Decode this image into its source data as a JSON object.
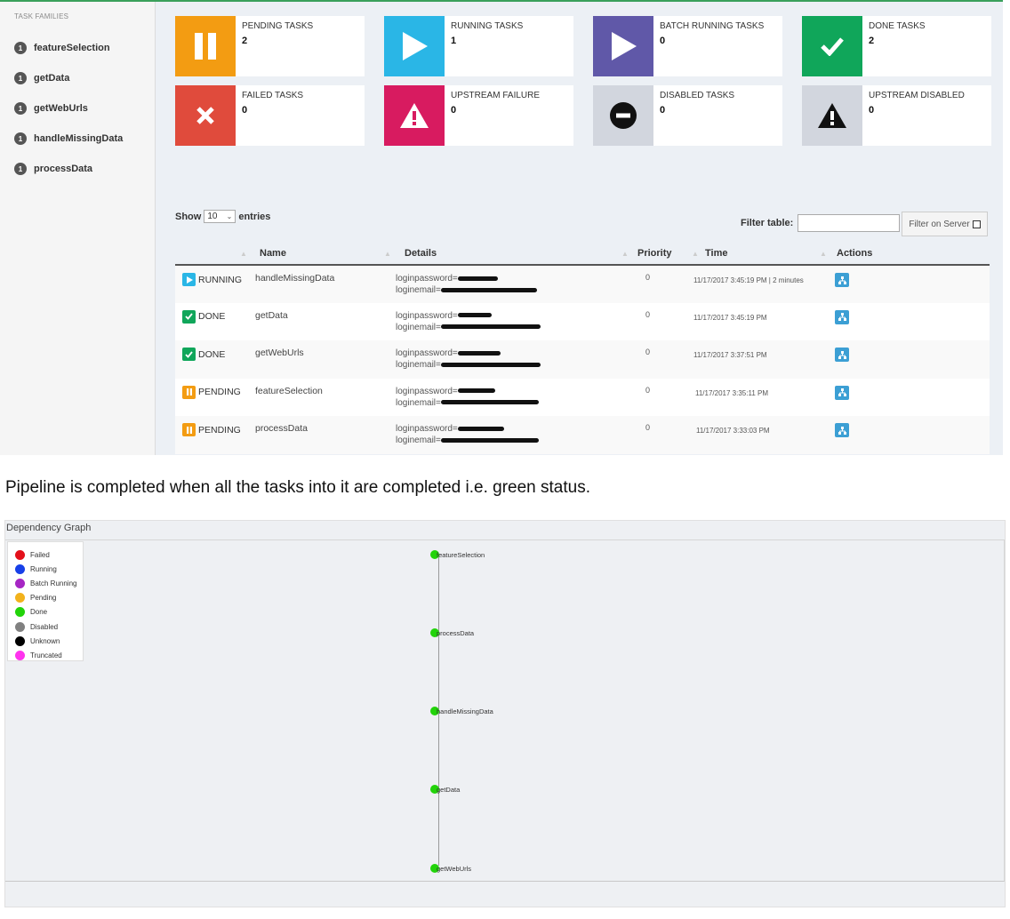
{
  "sidebar": {
    "header": "TASK FAMILIES",
    "items": [
      {
        "count": "1",
        "label": "featureSelection"
      },
      {
        "count": "1",
        "label": "getData"
      },
      {
        "count": "1",
        "label": "getWebUrls"
      },
      {
        "count": "1",
        "label": "handleMissingData"
      },
      {
        "count": "1",
        "label": "processData"
      }
    ]
  },
  "status_boxes": [
    {
      "label": "PENDING TASKS",
      "count": "2",
      "color": "#f39c12",
      "icon": "pause-icon"
    },
    {
      "label": "RUNNING TASKS",
      "count": "1",
      "color": "#2ab6e6",
      "icon": "play-icon"
    },
    {
      "label": "BATCH RUNNING TASKS",
      "count": "0",
      "color": "#6058a8",
      "icon": "play-icon"
    },
    {
      "label": "DONE TASKS",
      "count": "2",
      "color": "#10a65a",
      "icon": "check-icon"
    },
    {
      "label": "FAILED TASKS",
      "count": "0",
      "color": "#e04b3c",
      "icon": "x-icon"
    },
    {
      "label": "UPSTREAM FAILURE",
      "count": "0",
      "color": "#d81b60",
      "icon": "warning-icon"
    },
    {
      "label": "DISABLED TASKS",
      "count": "0",
      "color": "#d2d6de",
      "icon": "minus-circle-icon"
    },
    {
      "label": "UPSTREAM DISABLED",
      "count": "0",
      "color": "#d2d6de",
      "icon": "warning-icon"
    }
  ],
  "table_controls": {
    "show_label": "Show",
    "entries_value": "10",
    "entries_label": "entries",
    "filter_label": "Filter table:",
    "filter_value": "",
    "filter_server_label": "Filter on Server"
  },
  "table": {
    "headers": [
      "Name",
      "Details",
      "Priority",
      "Time",
      "Actions"
    ],
    "rows": [
      {
        "status": "RUNNING",
        "status_color": "#2ab6e6",
        "name": "handleMissingData",
        "detail1": "loginpassword=",
        "detail2": "loginemail=",
        "priority": "0",
        "time": "11/17/2017 3:45:19 PM | 2 minutes"
      },
      {
        "status": "DONE",
        "status_color": "#10a65a",
        "name": "getData",
        "detail1": "loginpassword=",
        "detail2": "loginemail=",
        "priority": "0",
        "time": "11/17/2017 3:45:19 PM"
      },
      {
        "status": "DONE",
        "status_color": "#10a65a",
        "name": "getWebUrls",
        "detail1": "loginpassword=",
        "detail2": "loginemail=",
        "priority": "0",
        "time": "11/17/2017 3:37:51 PM"
      },
      {
        "status": "PENDING",
        "status_color": "#f39c12",
        "name": "featureSelection",
        "detail1": "loginpassword=",
        "detail2": "loginemail=",
        "priority": "0",
        "time": "11/17/2017 3:35:11 PM"
      },
      {
        "status": "PENDING",
        "status_color": "#f39c12",
        "name": "processData",
        "detail1": "loginpassword=",
        "detail2": "loginemail=",
        "priority": "0",
        "time": "11/17/2017 3:33:03 PM"
      }
    ]
  },
  "caption": "Pipeline is completed when all the tasks into it are completed i.e. green status.",
  "graph": {
    "title": "Dependency Graph",
    "legend": [
      {
        "label": "Failed",
        "color": "#e3101a"
      },
      {
        "label": "Running",
        "color": "#1740e8"
      },
      {
        "label": "Batch Running",
        "color": "#a626c4"
      },
      {
        "label": "Pending",
        "color": "#f2b21c"
      },
      {
        "label": "Done",
        "color": "#22d30a"
      },
      {
        "label": "Disabled",
        "color": "#808080"
      },
      {
        "label": "Unknown",
        "color": "#000000"
      },
      {
        "label": "Truncated",
        "color": "#ff33ee"
      }
    ],
    "nodes": [
      {
        "label": "featureSelection",
        "status": "Done"
      },
      {
        "label": "processData",
        "status": "Done"
      },
      {
        "label": "handleMissingData",
        "status": "Done"
      },
      {
        "label": "getData",
        "status": "Done"
      },
      {
        "label": "getWebUrls",
        "status": "Done"
      }
    ]
  }
}
